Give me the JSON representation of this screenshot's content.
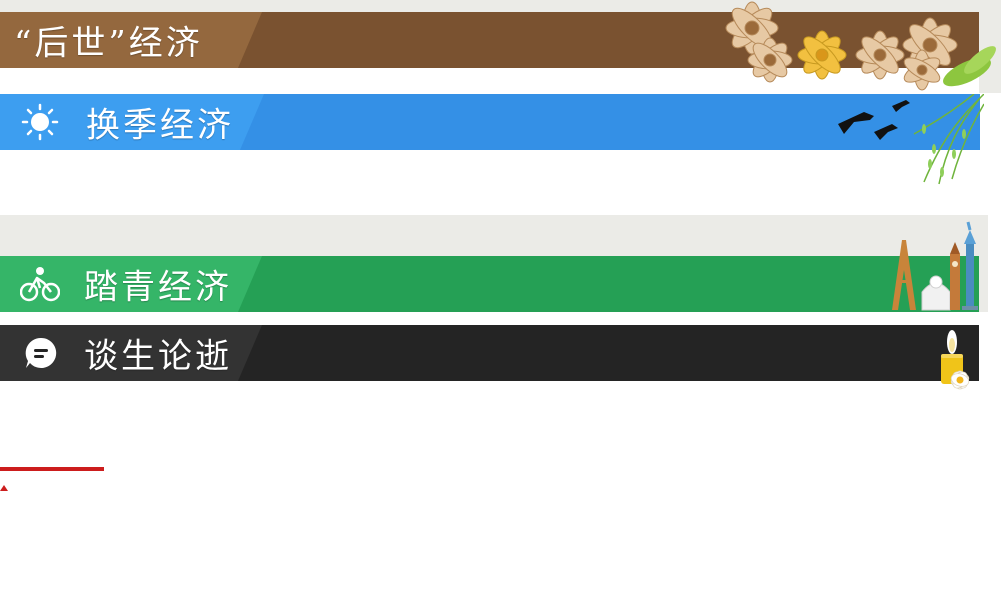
{
  "banners": [
    {
      "title": "“后世”经济",
      "icon": "none",
      "bar_color": "#7a5230",
      "title_bg": "#94683e",
      "decor": "flower-bouquet-decoration"
    },
    {
      "title": "换季经济",
      "icon": "sun-icon",
      "bar_color": "#3490e6",
      "title_bg": "#3d9ef0",
      "decor": "swallows-willow-decoration"
    },
    {
      "title": "踏青经济",
      "icon": "cyclist-icon",
      "bar_color": "#25a055",
      "title_bg": "#35b568",
      "decor": "world-landmarks-decoration"
    },
    {
      "title": "谈生论逝",
      "icon": "chat-bubble-icon",
      "bar_color": "#242424",
      "title_bg": "#333333",
      "decor": "candle-flower-decoration"
    }
  ],
  "colors": {
    "strip_grey": "#ebebe7",
    "accent_red": "#cc1d1d"
  }
}
